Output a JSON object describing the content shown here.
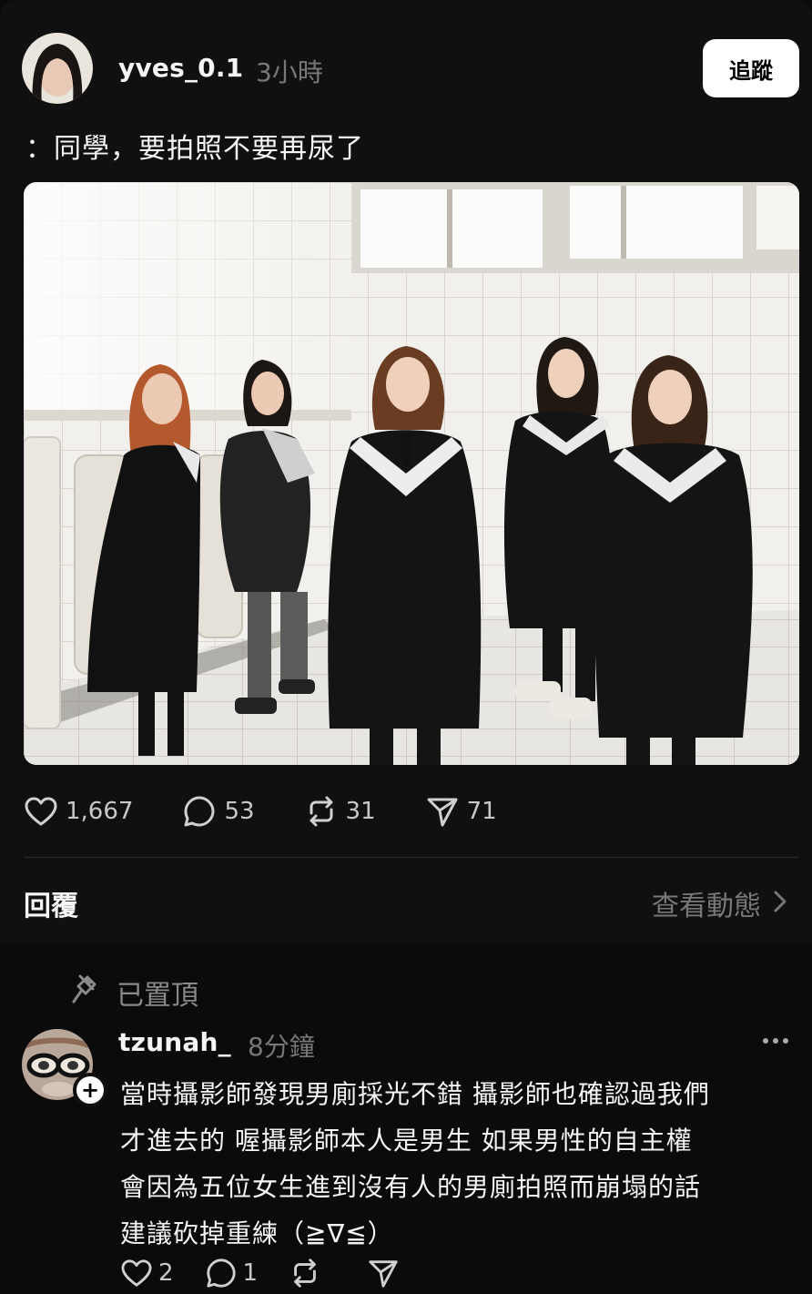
{
  "post": {
    "username": "yves_0.1",
    "time": "3小時",
    "follow_label": "追蹤",
    "caption": "：同學，要拍照不要再尿了",
    "image": "graduation-group-photo",
    "likes": "1,667",
    "comments": "53",
    "reposts": "31",
    "shares": "71"
  },
  "replies_header": {
    "label": "回覆",
    "activity_link": "查看動態"
  },
  "pinned_comment": {
    "pinned_label": "已置頂",
    "username": "tzunah_",
    "time": "8分鐘",
    "lines": [
      "當時攝影師發現男廁採光不錯 攝影師也確認過我們",
      "才進去的 喔攝影師本人是男生 如果男性的自主權",
      "會因為五位女生進到沒有人的男廁拍照而崩塌的話",
      "建議砍掉重練（≧∇≦）"
    ],
    "likes": "2",
    "comments": "1"
  },
  "colors": {
    "background": "#101010",
    "text": "#f3f5f7",
    "muted": "#777777",
    "divider": "#2a2a2a"
  },
  "icons": [
    "heart-icon",
    "comment-icon",
    "repost-icon",
    "share-icon",
    "chevron-right-icon",
    "pin-icon",
    "more-icon",
    "plus-icon"
  ]
}
